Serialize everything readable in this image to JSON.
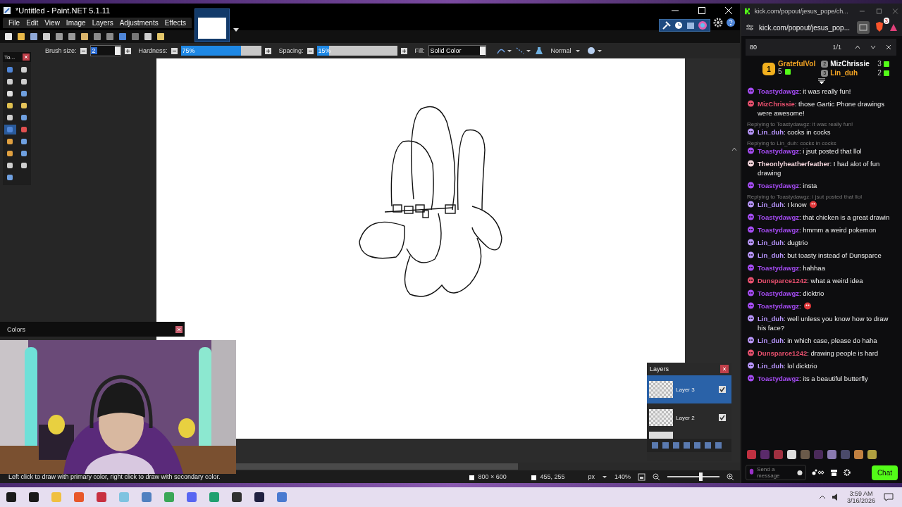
{
  "paint_window": {
    "title": "*Untitled - Paint.NET 5.1.11",
    "menu": [
      "File",
      "Edit",
      "View",
      "Image",
      "Layers",
      "Adjustments",
      "Effects"
    ],
    "tool_options": {
      "brush_size_label": "Brush size:",
      "brush_size": "2",
      "hardness_label": "Hardness:",
      "hardness": {
        "reading": "75%",
        "level": 0.75
      },
      "spacing_label": "Spacing:",
      "spacing": {
        "reading": "15%",
        "level": 0.15
      },
      "fill_label": "Fill:",
      "fill": "Solid Color",
      "blend_mode": "Normal"
    },
    "tools_panel": {
      "title": "To...",
      "tools": [
        {
          "selected": false
        },
        {
          "selected": false
        },
        {
          "selected": false
        },
        {
          "selected": false
        },
        {
          "selected": false
        },
        {
          "selected": false
        },
        {
          "selected": false
        },
        {
          "selected": false
        },
        {
          "selected": false
        },
        {
          "selected": false
        },
        {
          "selected": true
        },
        {
          "selected": false
        },
        {
          "selected": false
        },
        {
          "selected": false
        },
        {
          "selected": false
        },
        {
          "selected": false
        },
        {
          "selected": false
        },
        {
          "selected": false
        },
        {
          "selected": false
        }
      ]
    },
    "colors_panel": {
      "title": "Colors"
    },
    "layers_panel": {
      "title": "Layers",
      "layers": [
        {
          "name": "Layer 3",
          "selected": true,
          "visible": true
        },
        {
          "name": "Layer 2",
          "selected": false,
          "visible": true
        }
      ]
    },
    "status_bar": {
      "hint": "Left click to draw with primary color, right click to draw with secondary color.",
      "image_size": "800 × 600",
      "cursor": "455, 255",
      "unit": "px",
      "zoom": "140%",
      "zoom_slider": {
        "level": 0.63
      }
    }
  },
  "chat_window": {
    "tab_title": "kick.com/popout/jesus_pope/ch...",
    "address": "kick.com/popout/jesus_pop...",
    "extension_badge": "3",
    "find": {
      "query": "80",
      "count": "1/1"
    },
    "leaderboard": [
      {
        "rank": "1",
        "name": "GratefulVol",
        "count": "5",
        "color": "#f5a524"
      },
      {
        "rank": "2",
        "name": "MizChrissie",
        "count": "3",
        "color": "#ffffff"
      },
      {
        "rank": "3",
        "name": "Lin_duh",
        "count": "2",
        "color": "#f5a524"
      }
    ],
    "messages": [
      {
        "user": "Toastydawgz",
        "color": "#a64cf5",
        "text": ": it was really fun!"
      },
      {
        "user": "MizChrissie",
        "color": "#e8506e",
        "text": ": those Gartic Phone drawings were awesome!"
      },
      {
        "reply": "Replying to Toastydawgz: it was really fun!",
        "user": "Lin_duh",
        "color": "#b996ff",
        "text": ": cocks in cocks"
      },
      {
        "reply": "Replying to Lin_duh: cocks in cocks",
        "user": "Toastydawgz",
        "color": "#a64cf5",
        "text": ": i jsut posted that llol"
      },
      {
        "user": "Theonlyheatherfeather",
        "color": "#f4d6dc",
        "text": ": I had alot of fun drawing"
      },
      {
        "user": "Toastydawgz",
        "color": "#a64cf5",
        "text": ": insta"
      },
      {
        "reply": "Replying to Toastydawgz: i jsut posted that llol",
        "user": "Lin_duh",
        "color": "#b996ff",
        "text": ": I know",
        "emote": true
      },
      {
        "user": "Toastydawgz",
        "color": "#a64cf5",
        "text": ": that chicken is a great drawin"
      },
      {
        "user": "Toastydawgz",
        "color": "#a64cf5",
        "text": ": hmmm a weird pokemon"
      },
      {
        "user": "Lin_duh",
        "color": "#b996ff",
        "text": ": dugtrio"
      },
      {
        "user": "Lin_duh",
        "color": "#b996ff",
        "text": ": but toasty instead of Dunsparce"
      },
      {
        "user": "Toastydawgz",
        "color": "#a64cf5",
        "text": ": hahhaa"
      },
      {
        "user": "Dunsparce1242",
        "color": "#e8506e",
        "text": ": what a weird idea"
      },
      {
        "user": "Toastydawgz",
        "color": "#a64cf5",
        "text": ": dicktrio"
      },
      {
        "user": "Toastydawgz",
        "color": "#a64cf5",
        "text": ":",
        "emote": true
      },
      {
        "user": "Lin_duh",
        "color": "#b996ff",
        "text": ": well unless you know how to draw his face?"
      },
      {
        "user": "Lin_duh",
        "color": "#b996ff",
        "text": ": in which case, please do haha"
      },
      {
        "user": "Dunsparce1242",
        "color": "#e8506e",
        "text": ": drawing people is hard"
      },
      {
        "user": "Lin_duh",
        "color": "#b996ff",
        "text": ": lol dicktrio"
      },
      {
        "user": "Toastydawgz",
        "color": "#a64cf5",
        "text": ": its a beautiful butterfly"
      }
    ],
    "input_placeholder": "Send a message",
    "chat_button": "Chat"
  },
  "taskbar": {
    "time": "3:59 AM",
    "date": "3/16/2026"
  }
}
